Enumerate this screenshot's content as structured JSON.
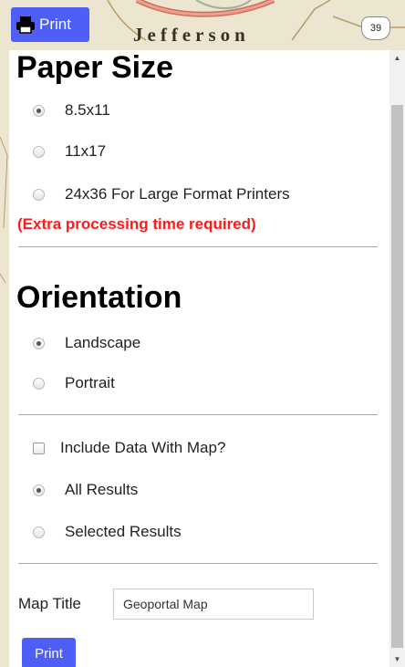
{
  "map": {
    "town_label": "Jefferson",
    "route_shield": "39"
  },
  "toolbar": {
    "print_label": "Print"
  },
  "paper_size": {
    "heading": "Paper Size",
    "options": [
      {
        "label": "8.5x11",
        "selected": true
      },
      {
        "label": "11x17",
        "selected": false
      },
      {
        "label": "24x36 For Large Format Printers",
        "selected": false
      }
    ],
    "warning": "(Extra processing time required)"
  },
  "orientation": {
    "heading": "Orientation",
    "options": [
      {
        "label": "Landscape",
        "selected": true
      },
      {
        "label": "Portrait",
        "selected": false
      }
    ]
  },
  "data_options": {
    "include_label": "Include Data With Map?",
    "include_checked": false,
    "results": [
      {
        "label": "All Results",
        "selected": true
      },
      {
        "label": "Selected Results",
        "selected": false
      }
    ]
  },
  "map_title": {
    "label": "Map Title",
    "value": "Geoportal Map"
  },
  "submit": {
    "label": "Print"
  },
  "colors": {
    "accent": "#4d5ff6",
    "warning": "#ff1a1a"
  }
}
